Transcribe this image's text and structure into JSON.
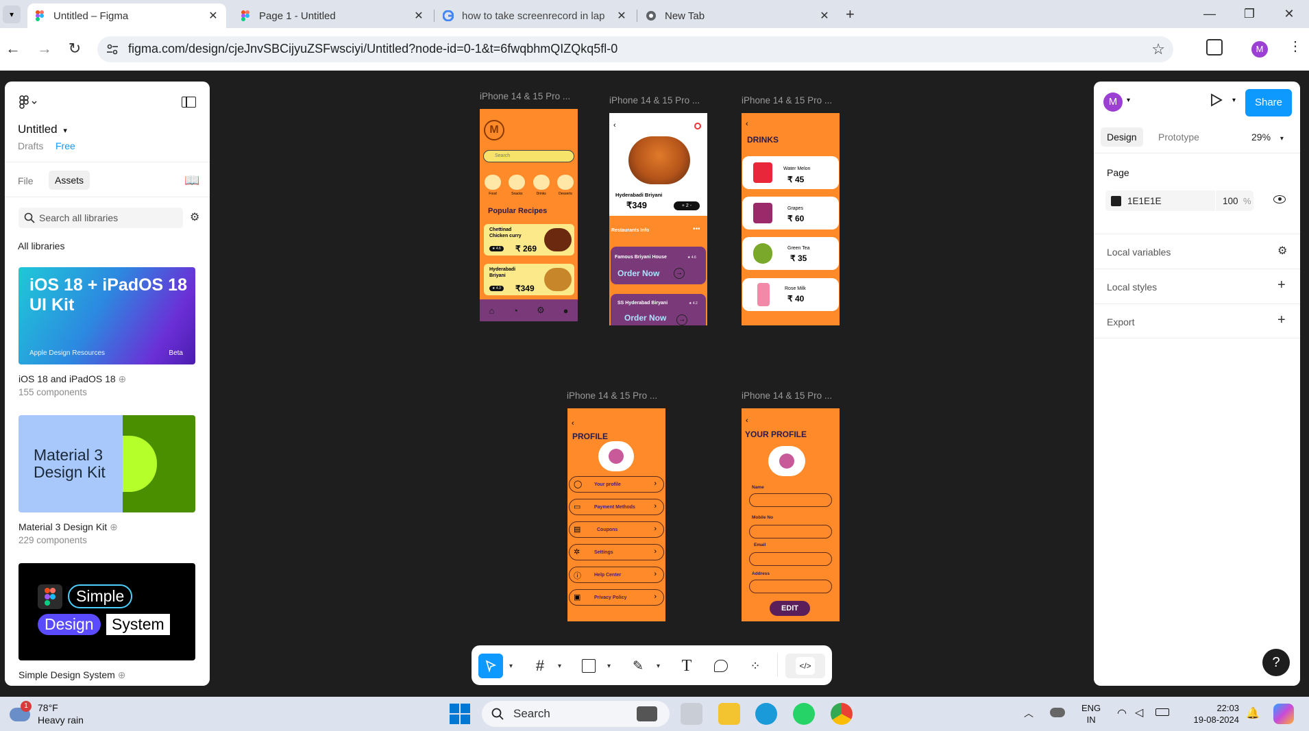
{
  "browser": {
    "tabs": [
      {
        "title": "Untitled – Figma",
        "active": true
      },
      {
        "title": "Page 1 - Untitled",
        "active": false
      },
      {
        "title": "how to take screenrecord in lap",
        "active": false
      },
      {
        "title": "New Tab",
        "active": false
      }
    ],
    "url": "figma.com/design/cjeJnvSBCijyuZSFwsciyi/Untitled?node-id=0-1&t=6fwqbhmQIZQkq5fl-0",
    "profile_initial": "M"
  },
  "left_panel": {
    "file_title": "Untitled",
    "drafts": "Drafts",
    "plan": "Free",
    "tab_file": "File",
    "tab_assets": "Assets",
    "search_placeholder": "Search all libraries",
    "all_libraries": "All libraries",
    "libraries": [
      {
        "name": "iOS 18 and iPadOS 18",
        "count": "155 components",
        "cover_title": "iOS 18 + iPadOS 18 UI Kit",
        "cover_note": "Apple Design Resources",
        "cover_badge": "Beta"
      },
      {
        "name": "Material 3 Design Kit",
        "count": "229 components",
        "cover_title": "Material 3 Design Kit"
      },
      {
        "name": "Simple Design System",
        "count": "",
        "cover_words": [
          "Simple",
          "Design",
          "System"
        ]
      }
    ]
  },
  "canvas": {
    "frame_label": "iPhone 14 & 15 Pro ...",
    "home": {
      "search": "Search",
      "categories": [
        "Food",
        "Snacks",
        "Drinks",
        "Desserts"
      ],
      "section": "Popular Recipes",
      "recipes": [
        {
          "name": "Chettinad Chicken curry",
          "rating": "4.6",
          "price": "₹ 269"
        },
        {
          "name": "Hyderabadi Briyani",
          "rating": "4.3",
          "price": "₹349"
        }
      ]
    },
    "detail": {
      "dish": "Hyderabadi Briyani",
      "price": "₹349",
      "qty": "+ 2 -",
      "info": "Restaurants Info",
      "restaurants": [
        {
          "name": "Famous Briyani House",
          "rating": "4.6",
          "cta": "Order Now"
        },
        {
          "name": "SS Hyderabad Biryani",
          "rating": "4.2",
          "cta": "Order Now"
        }
      ]
    },
    "drinks": {
      "title": "DRINKS",
      "items": [
        {
          "name": "Water Melon",
          "price": "₹ 45"
        },
        {
          "name": "Grapes",
          "price": "₹ 60"
        },
        {
          "name": "Green Tea",
          "price": "₹ 35"
        },
        {
          "name": "Rose Milk",
          "price": "₹ 40"
        }
      ]
    },
    "profile": {
      "title": "PROFILE",
      "menu": [
        "Your profile",
        "Payment Methods",
        "Coupons",
        "Settings",
        "Help Center",
        "Privacy Policy"
      ]
    },
    "your_profile": {
      "title": "YOUR PROFILE",
      "fields": [
        "Name",
        "Mobile No",
        "Email",
        "Address"
      ],
      "button": "EDIT"
    }
  },
  "right_panel": {
    "avatar": "M",
    "share": "Share",
    "tab_design": "Design",
    "tab_prototype": "Prototype",
    "zoom": "29%",
    "page_label": "Page",
    "page_color": "1E1E1E",
    "page_opacity": "100",
    "page_opacity_unit": "%",
    "local_variables": "Local variables",
    "local_styles": "Local styles",
    "export": "Export"
  },
  "taskbar": {
    "weather_temp": "78°F",
    "weather_desc": "Heavy rain",
    "weather_badge": "1",
    "search": "Search",
    "lang_top": "ENG",
    "lang_bottom": "IN",
    "time": "22:03",
    "date": "19-08-2024"
  },
  "colors": {
    "figma_blue": "#0d99ff",
    "frame_orange": "#ff8a2a",
    "profile_purple": "#9c3fd3",
    "canvas_bg": "#1e1e1e"
  }
}
